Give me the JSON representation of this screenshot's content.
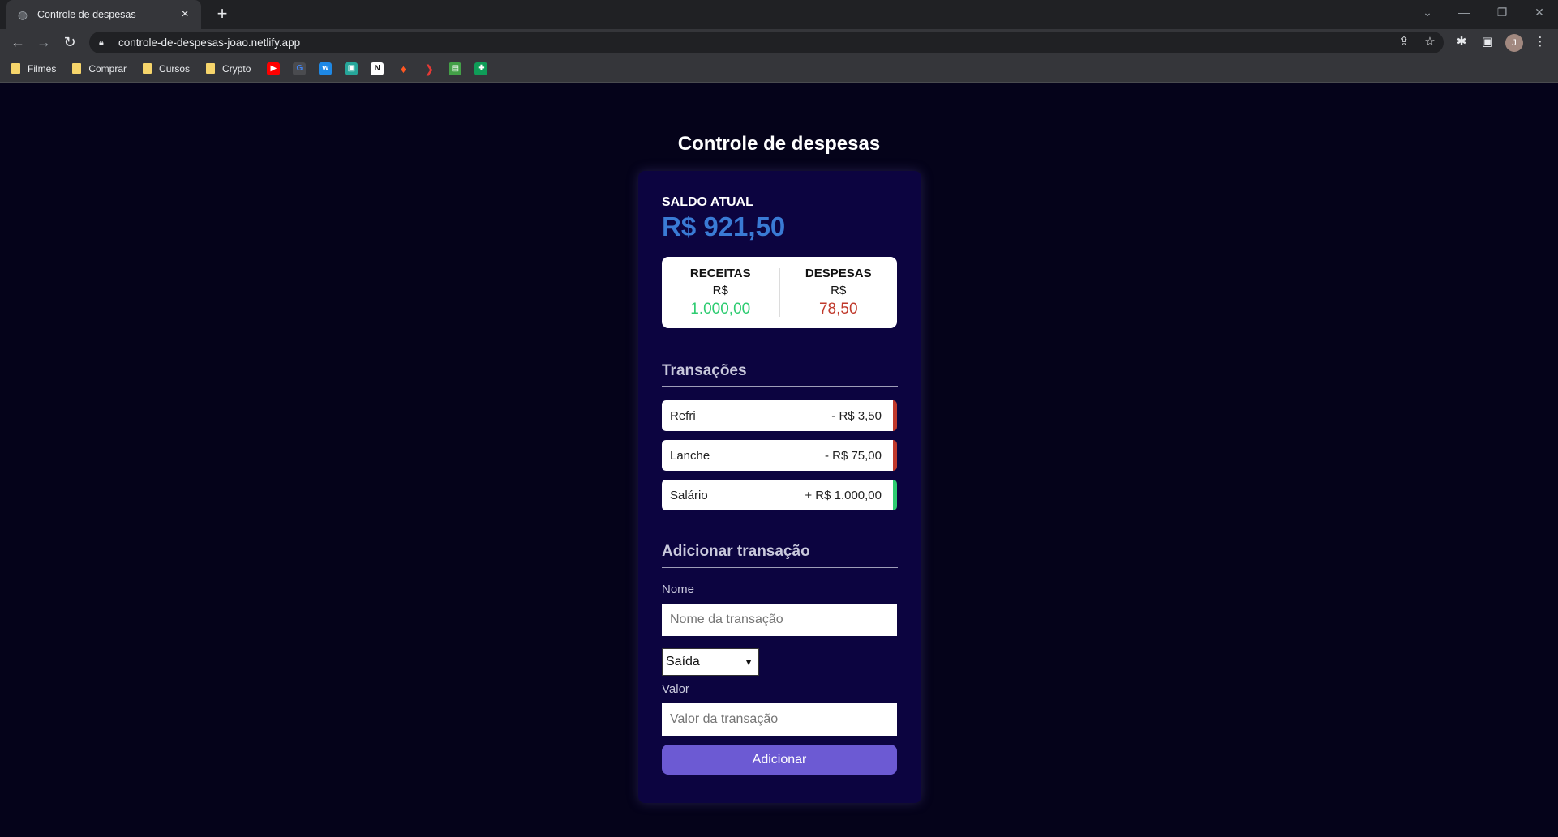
{
  "browser": {
    "tab_title": "Controle de despesas",
    "url": "controle-de-despesas-joao.netlify.app",
    "avatar_initial": "J",
    "bookmarks": [
      {
        "label": "Filmes",
        "type": "folder"
      },
      {
        "label": "Comprar",
        "type": "folder"
      },
      {
        "label": "Cursos",
        "type": "folder"
      },
      {
        "label": "Crypto",
        "type": "folder"
      }
    ],
    "bookmark_icons": [
      {
        "name": "youtube-icon",
        "color": "#ff0000",
        "glyph": "▶"
      },
      {
        "name": "google-icon",
        "color": "#4285f4",
        "glyph": "G"
      },
      {
        "name": "app-w-icon",
        "color": "#1e88e5",
        "glyph": "w"
      },
      {
        "name": "app-teal-icon",
        "color": "#26a69a",
        "glyph": "▣"
      },
      {
        "name": "notion-icon",
        "color": "#ffffff",
        "glyph": "N"
      },
      {
        "name": "tinder-icon",
        "color": "#ff5722",
        "glyph": "♦"
      },
      {
        "name": "arrow-app-icon",
        "color": "#e53935",
        "glyph": "❯"
      },
      {
        "name": "app-green-icon",
        "color": "#43a047",
        "glyph": "▤"
      },
      {
        "name": "sheets-icon",
        "color": "#0f9d58",
        "glyph": "✚"
      }
    ]
  },
  "app": {
    "title": "Controle de despesas",
    "balance_label": "SALDO ATUAL",
    "balance_value": "R$ 921,50",
    "income_label": "RECEITAS",
    "income_currency": "R$",
    "income_value": "1.000,00",
    "expense_label": "DESPESAS",
    "expense_currency": "R$",
    "expense_value": "78,50",
    "transactions_title": "Transações",
    "transactions": [
      {
        "name": "Refri",
        "amount": "- R$ 3,50",
        "type": "minus"
      },
      {
        "name": "Lanche",
        "amount": "- R$ 75,00",
        "type": "minus"
      },
      {
        "name": "Salário",
        "amount": "+ R$ 1.000,00",
        "type": "plus"
      }
    ],
    "add_title": "Adicionar transação",
    "name_label": "Nome",
    "name_placeholder": "Nome da transação",
    "type_selected": "Saída",
    "value_label": "Valor",
    "value_placeholder": "Valor da transação",
    "add_button": "Adicionar"
  },
  "colors": {
    "background": "#05031a",
    "card": "#0c0440",
    "balance": "#3a7bd5",
    "income": "#2ecc71",
    "expense": "#c0392b",
    "button": "#6c5ad3"
  }
}
